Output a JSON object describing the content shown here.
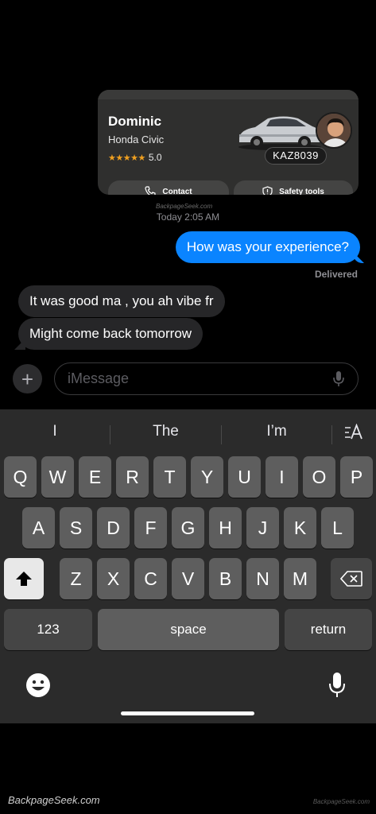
{
  "ride_card": {
    "driver_name": "Dominic",
    "car_model": "Honda Civic",
    "stars": "★★★★★",
    "rating": "5.0",
    "plate": "KAZ8039",
    "contact_label": "Contact",
    "safety_label": "Safety tools"
  },
  "watermark_small": "BackpageSeek.com",
  "timestamp": "Today 2:05 AM",
  "messages": {
    "sent": "How was your experience?",
    "delivered": "Delivered",
    "received": [
      "It was good ma , you ah vibe fr",
      "Might come back tomorrow"
    ]
  },
  "compose": {
    "plus": "+",
    "placeholder": "iMessage"
  },
  "keyboard": {
    "suggestions": [
      "I",
      "The",
      "I’m"
    ],
    "row1": [
      "Q",
      "W",
      "E",
      "R",
      "T",
      "Y",
      "U",
      "I",
      "O",
      "P"
    ],
    "row2": [
      "A",
      "S",
      "D",
      "F",
      "G",
      "H",
      "J",
      "K",
      "L"
    ],
    "row3": [
      "Z",
      "X",
      "C",
      "V",
      "B",
      "N",
      "M"
    ],
    "numbers_label": "123",
    "space_label": "space",
    "return_label": "return"
  },
  "watermark": "BackpageSeek.com",
  "watermark_right": "BackpageSeek.com",
  "colors": {
    "sent_bubble": "#0a84ff",
    "received_bubble": "#262628",
    "keyboard_bg": "#2b2b2b",
    "star": "#f0a020"
  },
  "icons": {
    "contact": "phone-icon",
    "safety": "shield-icon",
    "dictate": "microphone-icon",
    "shift": "shift-arrow-icon",
    "delete": "backspace-icon",
    "emoji": "emoji-icon",
    "text_format": "text-format-icon"
  }
}
